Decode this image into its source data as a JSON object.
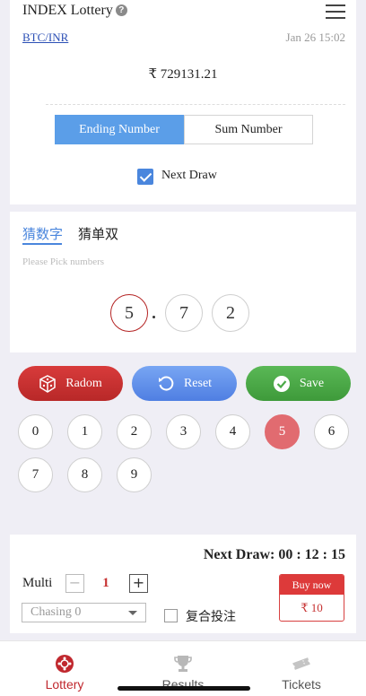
{
  "header": {
    "title": "INDEX Lottery",
    "help_icon": "?",
    "pair": "BTC/INR",
    "datetime": "Jan 26 15:02",
    "price": "₹ 729131.21"
  },
  "mode_tabs": {
    "ending": "Ending Number",
    "sum": "Sum Number",
    "active": "ending"
  },
  "next_draw_checkbox": {
    "label": "Next Draw",
    "checked": true
  },
  "pick": {
    "tabs": [
      "猜数字",
      "猜单双"
    ],
    "active_tab": 0,
    "hint": "Please Pick numbers",
    "balls": [
      "5",
      "7",
      "2"
    ]
  },
  "actions": {
    "random": "Radom",
    "reset": "Reset",
    "save": "Save"
  },
  "numbers": [
    "0",
    "1",
    "2",
    "3",
    "4",
    "5",
    "6",
    "7",
    "8",
    "9"
  ],
  "selected_number": "5",
  "bet": {
    "next_draw": "Next Draw: 00 : 12 : 15",
    "multi_label": "Multi",
    "minus": "−",
    "plus": "+",
    "quantity": "1",
    "chasing": "Chasing 0",
    "compound_label": "复合投注",
    "buy_label": "Buy now",
    "buy_amount": "₹ 10"
  },
  "nav": {
    "lottery": "Lottery",
    "results": "Results",
    "tickets": "Tickets",
    "active": "lottery"
  },
  "colors": {
    "accent_blue": "#5b9ee8",
    "brand_red": "#c0282e",
    "save_green": "#4caa48"
  }
}
